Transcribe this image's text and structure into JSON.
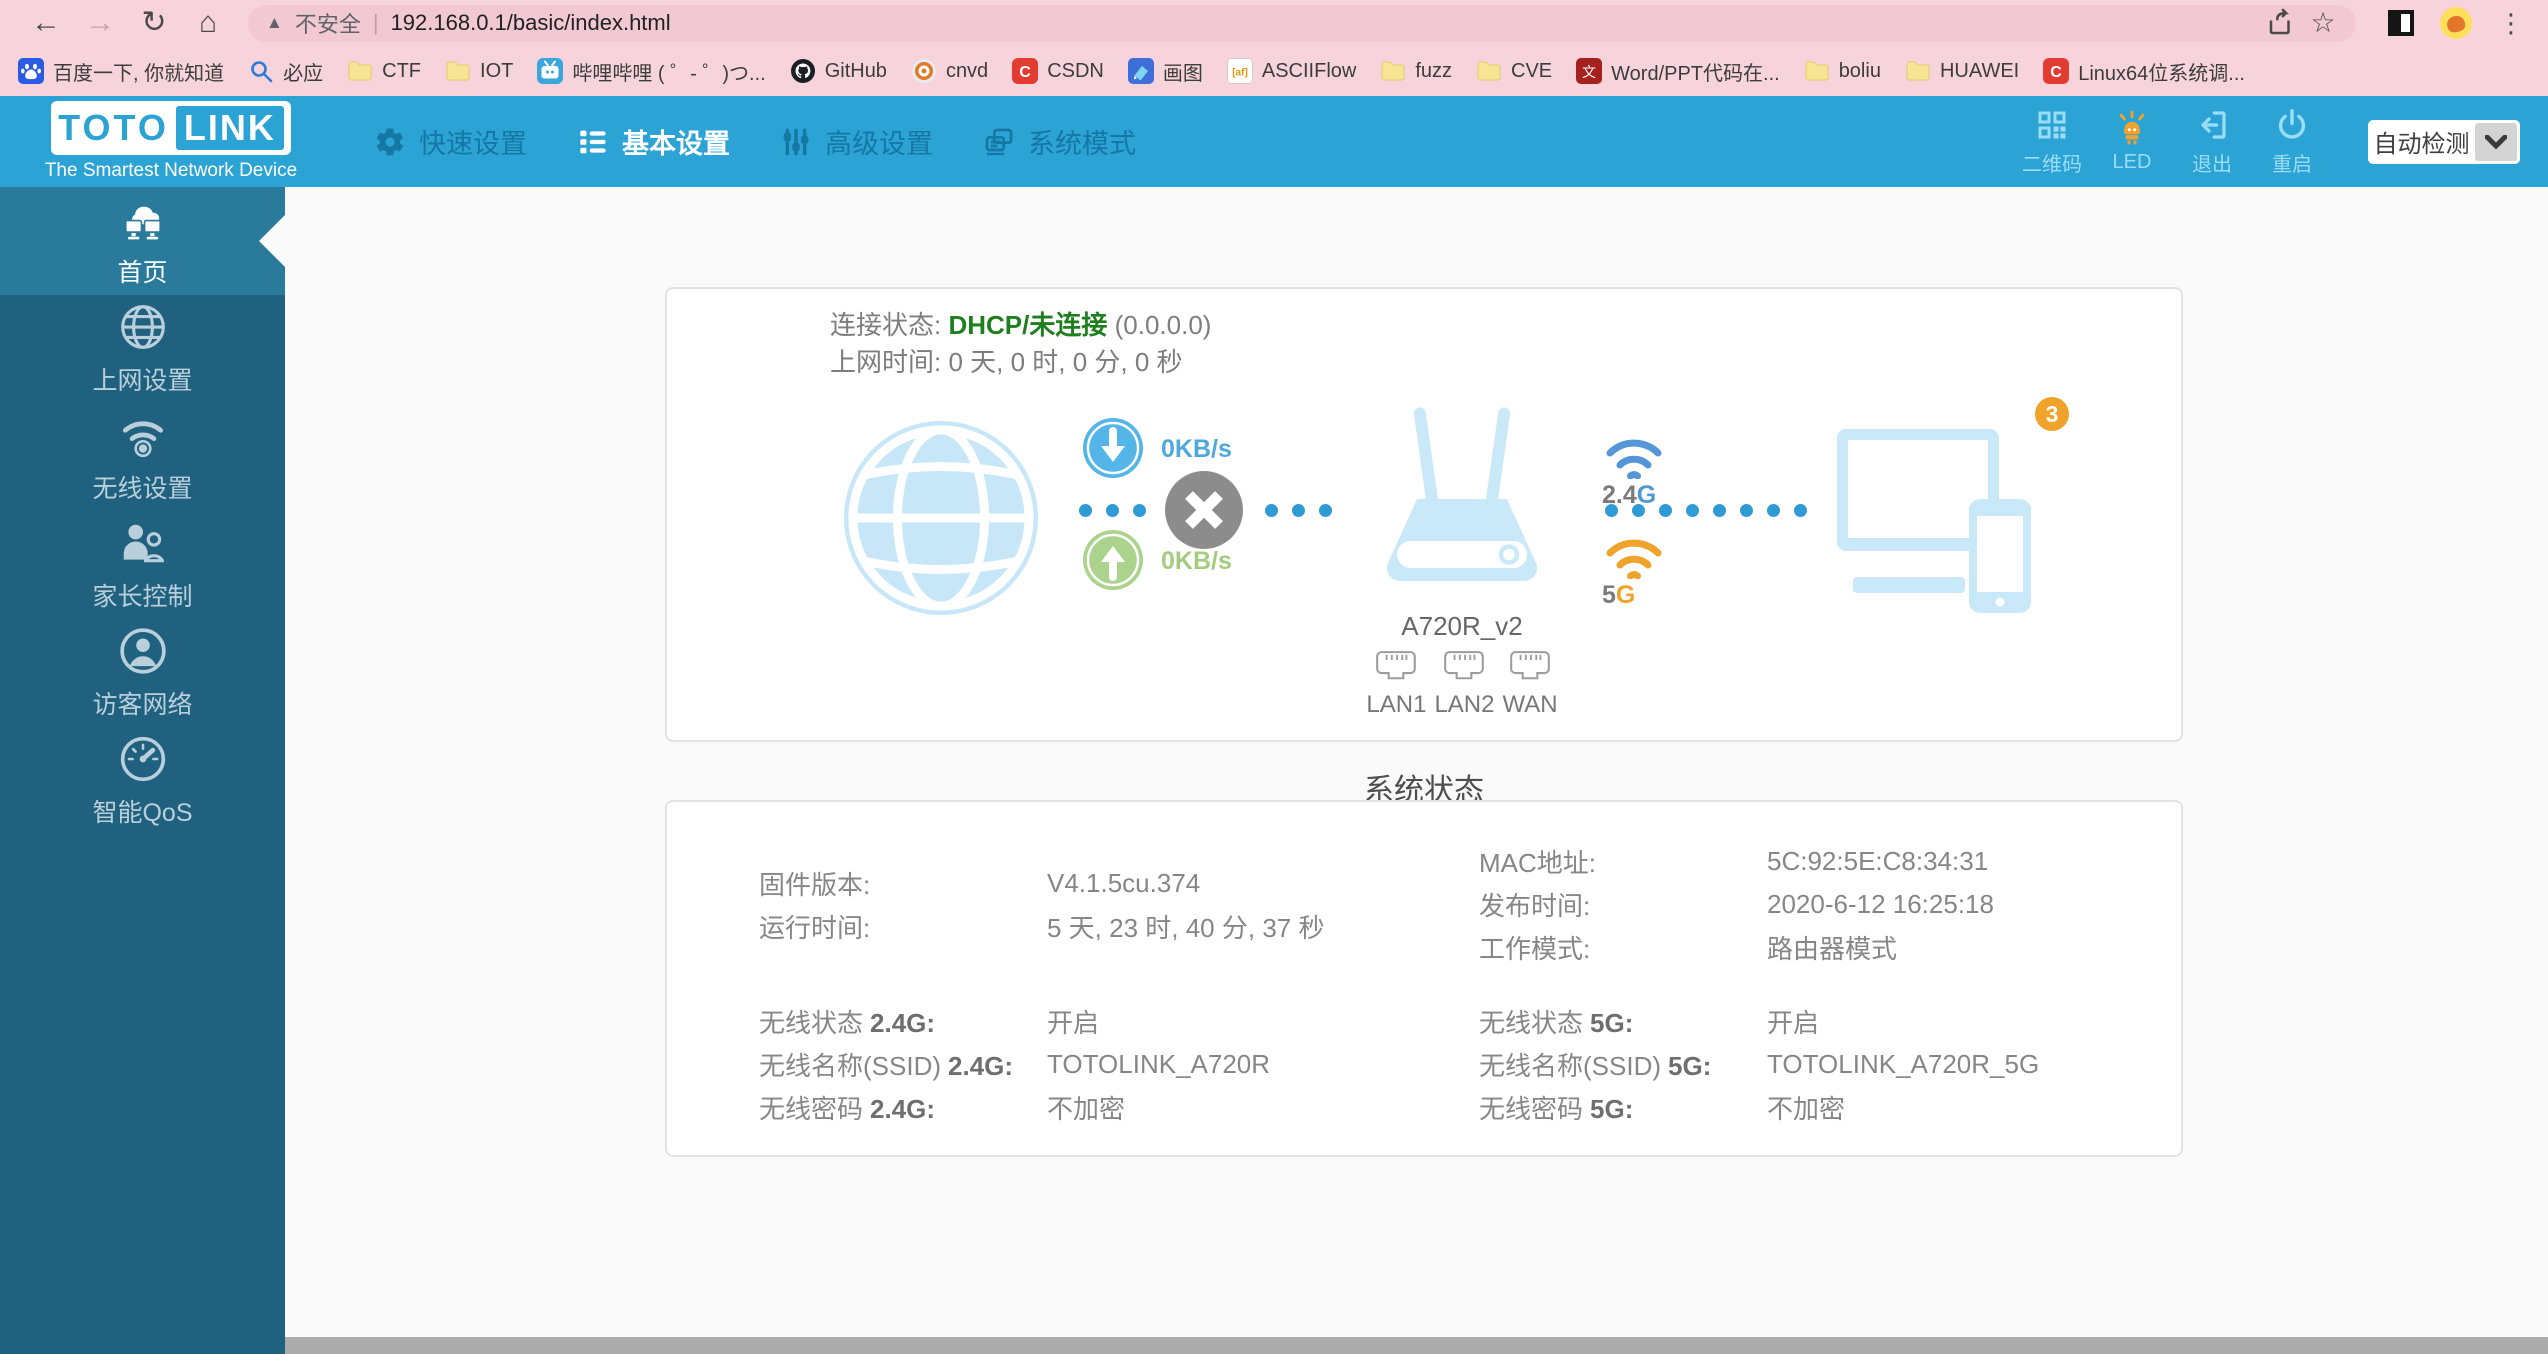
{
  "colors": {
    "accent": "#2BA3D4",
    "sidebar": "#20617F",
    "green": "#1E7F1E",
    "orange": "#EFA32B"
  },
  "browser": {
    "toolbar": {
      "security_label": "不安全",
      "divider": "|",
      "url": "192.168.0.1/basic/index.html"
    },
    "bookmarks": [
      {
        "label": "百度一下, 你就知道",
        "icon": "baidu-icon"
      },
      {
        "label": "必应",
        "icon": "search-icon"
      },
      {
        "label": "CTF",
        "icon": "folder-icon"
      },
      {
        "label": "IOT",
        "icon": "folder-icon"
      },
      {
        "label": "哔哩哔哩 ( ゜- ゜)つ...",
        "icon": "bilibili-icon"
      },
      {
        "label": "GitHub",
        "icon": "github-icon"
      },
      {
        "label": "cnvd",
        "icon": "cnvd-icon"
      },
      {
        "label": "CSDN",
        "icon": "csdn-icon"
      },
      {
        "label": "画图",
        "icon": "paint-icon"
      },
      {
        "label": "ASCIIFlow",
        "icon": "asciiflow-icon"
      },
      {
        "label": "fuzz",
        "icon": "folder-icon"
      },
      {
        "label": "CVE",
        "icon": "folder-icon"
      },
      {
        "label": "Word/PPT代码在...",
        "icon": "docer-icon"
      },
      {
        "label": "boliu",
        "icon": "folder-icon"
      },
      {
        "label": "HUAWEI",
        "icon": "folder-icon"
      },
      {
        "label": "Linux64位系统调...",
        "icon": "csdn-icon"
      }
    ]
  },
  "header": {
    "logo": {
      "toto": "TOTO",
      "link": "LINK",
      "tagline": "The Smartest Network Device"
    },
    "nav": [
      {
        "label": "快速设置",
        "icon": "gear-icon"
      },
      {
        "label": "基本设置",
        "icon": "list-icon",
        "active": true
      },
      {
        "label": "高级设置",
        "icon": "sliders-icon"
      },
      {
        "label": "系统模式",
        "icon": "stack-icon"
      }
    ],
    "actions": [
      {
        "label": "二维码",
        "icon": "qr-icon"
      },
      {
        "label": "LED",
        "icon": "led-icon"
      },
      {
        "label": "退出",
        "icon": "logout-icon"
      },
      {
        "label": "重启",
        "icon": "power-icon"
      }
    ],
    "detect_select": {
      "value": "自动检测"
    }
  },
  "sidebar": {
    "items": [
      {
        "label": "首页",
        "icon": "home-icon",
        "active": true
      },
      {
        "label": "上网设置",
        "icon": "globe-icon"
      },
      {
        "label": "无线设置",
        "icon": "wifi-icon"
      },
      {
        "label": "家长控制",
        "icon": "parental-icon"
      },
      {
        "label": "访客网络",
        "icon": "guest-icon"
      },
      {
        "label": "智能QoS",
        "icon": "qos-icon"
      }
    ]
  },
  "status": {
    "connection_label": "连接状态:",
    "connection_value": "DHCP/未连接",
    "connection_ip": "(0.0.0.0)",
    "uptime_label": "上网时间:",
    "uptime_value": "0 天, 0 时, 0 分, 0 秒",
    "download_speed": "0KB/s",
    "upload_speed": "0KB/s",
    "router_model": "A720R_v2",
    "band_24_num": "2.4",
    "band_24_g": "G",
    "band_5_num": "5",
    "band_5_g": "G",
    "client_count": "3",
    "ports": [
      {
        "label": "LAN1"
      },
      {
        "label": "LAN2"
      },
      {
        "label": "WAN"
      }
    ]
  },
  "system": {
    "title": "系统状态",
    "info_left": [
      {
        "label": "固件版本:",
        "value": "V4.1.5cu.374"
      },
      {
        "label": "运行时间:",
        "value": "5 天, 23 时, 40 分, 37 秒"
      }
    ],
    "info_right": [
      {
        "label": "MAC地址:",
        "value": "5C:92:5E:C8:34:31"
      },
      {
        "label": "发布时间:",
        "value": "2020-6-12 16:25:18"
      },
      {
        "label": "工作模式:",
        "value": "路由器模式"
      }
    ],
    "wireless_left": [
      {
        "label": "无线状态",
        "band": "2.4G:",
        "value": "开启"
      },
      {
        "label": "无线名称(SSID)",
        "band": "2.4G:",
        "value": "TOTOLINK_A720R"
      },
      {
        "label": "无线密码",
        "band": "2.4G:",
        "value": "不加密"
      }
    ],
    "wireless_right": [
      {
        "label": "无线状态",
        "band": "5G:",
        "value": "开启"
      },
      {
        "label": "无线名称(SSID)",
        "band": "5G:",
        "value": "TOTOLINK_A720R_5G"
      },
      {
        "label": "无线密码",
        "band": "5G:",
        "value": "不加密"
      }
    ]
  }
}
